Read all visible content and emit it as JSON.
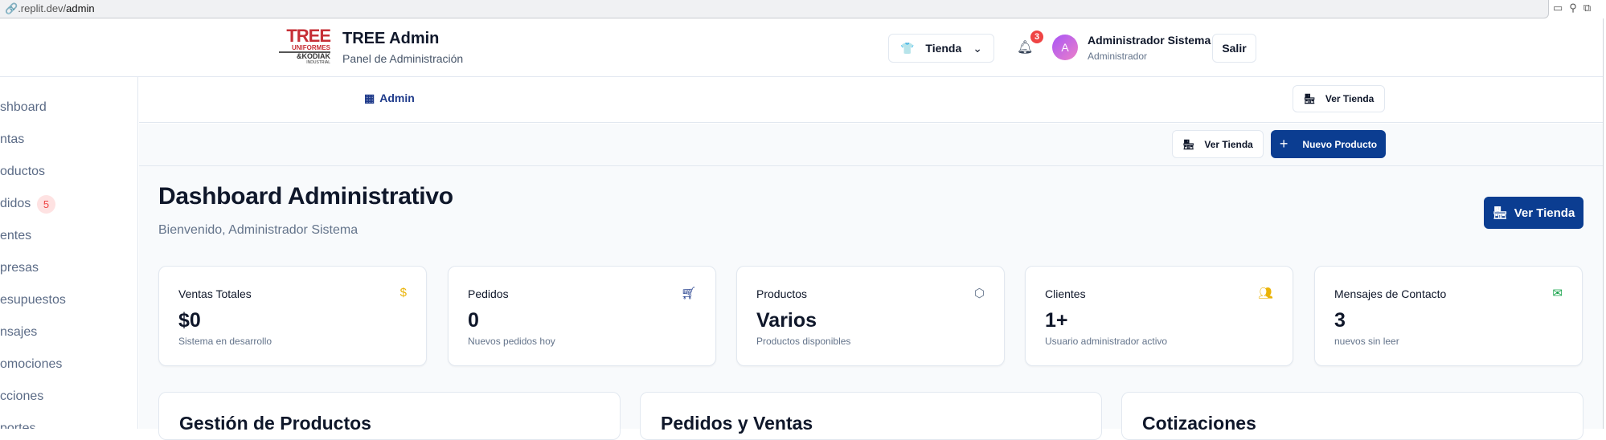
{
  "browser": {
    "url_prefix": ".replit.dev/",
    "url_path": "admin",
    "icons": [
      "devices-icon",
      "wrench-icon",
      "open-external-icon"
    ]
  },
  "header": {
    "logo_text": "TREE UNIFORMES & KODIAK INDUSTRIAL",
    "title": "TREE Admin",
    "subtitle": "Panel de Administración",
    "store_select": "Tienda",
    "notifications_count": "3",
    "user_initial": "A",
    "user_name": "Administrador Sistema",
    "user_role": "Administrador",
    "logout": "Salir"
  },
  "sidebar": {
    "items": [
      {
        "label": "shboard"
      },
      {
        "label": "ntas"
      },
      {
        "label": "oductos"
      },
      {
        "label": "didos",
        "badge": "5"
      },
      {
        "label": "entes"
      },
      {
        "label": "presas"
      },
      {
        "label": "esupuestos"
      },
      {
        "label": "nsajes"
      },
      {
        "label": "omociones"
      },
      {
        "label": "cciones"
      },
      {
        "label": "portes"
      }
    ]
  },
  "nav": {
    "admin_link": "Admin",
    "ver_tienda": "Ver Tienda"
  },
  "toolbar": {
    "ver_tienda": "Ver Tienda",
    "nuevo_producto": "Nuevo Producto"
  },
  "main": {
    "title": "Dashboard Administrativo",
    "welcome": "Bienvenido, Administrador Sistema",
    "ver_tienda": "Ver Tienda",
    "stats": [
      {
        "label": "Ventas Totales",
        "value": "$0",
        "sub": "Sistema en desarrollo",
        "icon": "dollar-icon",
        "color": "#eab308"
      },
      {
        "label": "Pedidos",
        "value": "0",
        "sub": "Nuevos pedidos hoy",
        "icon": "cart-icon",
        "color": "#1e3a8a"
      },
      {
        "label": "Productos",
        "value": "Varios",
        "sub": "Productos disponibles",
        "icon": "package-icon",
        "color": "#64748b"
      },
      {
        "label": "Clientes",
        "value": "1+",
        "sub": "Usuario administrador activo",
        "icon": "users-icon",
        "color": "#eab308"
      },
      {
        "label": "Mensajes de Contacto",
        "value": "3",
        "sub": "nuevos sin leer",
        "icon": "mail-icon",
        "color": "#16a34a"
      }
    ],
    "sections": [
      {
        "title": "Gestión de Productos"
      },
      {
        "title": "Pedidos y Ventas"
      },
      {
        "title": "Cotizaciones"
      }
    ]
  },
  "colors": {
    "primary": "#0b3d91",
    "badge": "#ef4444"
  }
}
